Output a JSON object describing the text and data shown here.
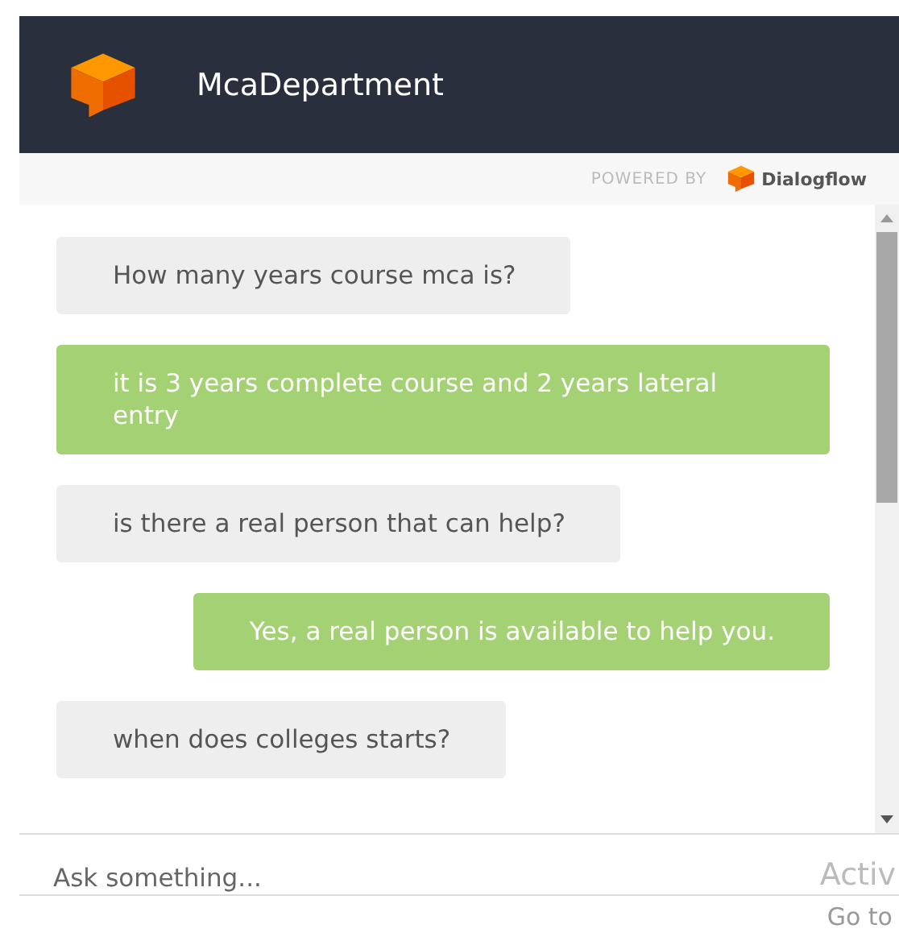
{
  "header": {
    "title": "McaDepartment"
  },
  "powered_by": {
    "label": "POWERED BY",
    "brand": "Dialogflow"
  },
  "messages": [
    {
      "kind": "user",
      "text": "How many years course mca is?"
    },
    {
      "kind": "bot",
      "text": "it is 3 years complete course and 2 years lateral entry"
    },
    {
      "kind": "user",
      "text": "is there a real person that can help?"
    },
    {
      "kind": "bot",
      "text": "Yes, a real person is available to help you."
    },
    {
      "kind": "user",
      "text": "when does colleges starts?"
    }
  ],
  "input": {
    "placeholder": "Ask something..."
  },
  "overlay": {
    "line_1": "Activ",
    "line_2": "Go to"
  }
}
